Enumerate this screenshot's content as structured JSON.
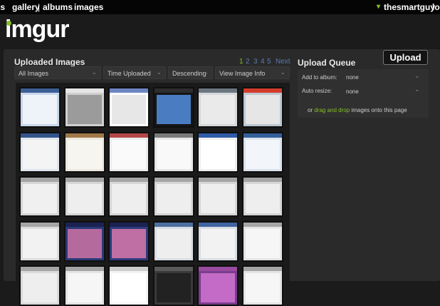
{
  "nav": {
    "left_partial": "ls",
    "gallery": "gallery",
    "separator": "|",
    "albums": "albums",
    "images": "images",
    "user_arrow": "▾",
    "username": "thesmartguy",
    "logout_partial": "log"
  },
  "logo": {
    "text": "imgur"
  },
  "uploaded": {
    "title": "Uploaded Images"
  },
  "pagination": {
    "pages": [
      "1",
      "2",
      "3",
      "4",
      "5"
    ],
    "current": "1",
    "next": "Next"
  },
  "filters": {
    "images": "All Images",
    "sort": "Time Uploaded",
    "order": "Descending",
    "view": "View Image Info",
    "chevron": "⌄"
  },
  "upload_queue": {
    "title": "Upload Queue",
    "button": "Upload",
    "album_label": "Add to album:",
    "album_value": "none",
    "resize_label": "Auto resize:",
    "resize_value": "none",
    "drop_or": "or",
    "drop_link": "drag and drop",
    "drop_rest": "images onto this page"
  },
  "colors": {
    "brand": "#85bf25",
    "link": "#5b7bb0",
    "page_bg": "#1b1b1b",
    "panel_bg": "#2a2a2a"
  },
  "thumbnails": [
    {
      "icon": "screenshot-blue",
      "bg": "#c9d7ec",
      "bar": "#3b5e95",
      "body": "#eef3fa"
    },
    {
      "icon": "meme-comic",
      "bg": "#cfcfcf",
      "bar": "#e5e5e5",
      "body": "#9b9b9b"
    },
    {
      "icon": "text-page",
      "bg": "#ffffff",
      "bar": "#6b86c2",
      "body": "#e7e7e7"
    },
    {
      "icon": "windows-satellite",
      "bg": "#151515",
      "bar": "#2d2d2d",
      "body": "#4a7cc2"
    },
    {
      "icon": "screenshot-window",
      "bg": "#d5d8da",
      "bar": "#6c7680",
      "body": "#eaeaea"
    },
    {
      "icon": "angry-birds-icon",
      "bg": "#bcc7d2",
      "bar": "#d33b2a",
      "body": "#e6e6e6"
    },
    {
      "icon": "app-store-page",
      "bg": "#e0e6ee",
      "bar": "#33558a",
      "body": "#f4f4f4"
    },
    {
      "icon": "icon-grid",
      "bg": "#ece8dd",
      "bar": "#a07948",
      "body": "#f7f5ef"
    },
    {
      "icon": "icon-grid",
      "bg": "#ececec",
      "bar": "#b54747",
      "body": "#fafafa"
    },
    {
      "icon": "icon-grid",
      "bg": "#e6e6e6",
      "bar": "#7a7a7a",
      "body": "#f9f9f9"
    },
    {
      "icon": "app-list",
      "bg": "#eeeeee",
      "bar": "#2f5aa8",
      "body": "#ffffff"
    },
    {
      "icon": "web-page",
      "bg": "#d9e2ec",
      "bar": "#335f9a",
      "body": "#f2f5f9"
    },
    {
      "icon": "screenshot",
      "bg": "#d6d6d6",
      "bar": "#a5a5a5",
      "body": "#f0f0f0"
    },
    {
      "icon": "screenshot",
      "bg": "#d6d6d6",
      "bar": "#a5a5a5",
      "body": "#eeeeee"
    },
    {
      "icon": "screenshot",
      "bg": "#d6d6d6",
      "bar": "#a5a5a5",
      "body": "#eeeeee"
    },
    {
      "icon": "screenshot",
      "bg": "#d6d6d6",
      "bar": "#a5a5a5",
      "body": "#eeeeee"
    },
    {
      "icon": "screenshot",
      "bg": "#d6d6d6",
      "bar": "#a5a5a5",
      "body": "#eeeeee"
    },
    {
      "icon": "screenshot",
      "bg": "#d6d6d6",
      "bar": "#a5a5a5",
      "body": "#eeeeee"
    },
    {
      "icon": "screenshot",
      "bg": "#dcdcdc",
      "bar": "#a5a5a5",
      "body": "#f2f2f2"
    },
    {
      "icon": "galaxy-wallpaper",
      "bg": "#2a3a78",
      "bar": "#1a2252",
      "body": "#b56a9e"
    },
    {
      "icon": "galaxy-wallpaper",
      "bg": "#2d3b7a",
      "bar": "#1a2252",
      "body": "#bf6fa4"
    },
    {
      "icon": "screenshot",
      "bg": "#d8dde4",
      "bar": "#4b6fa0",
      "body": "#eeeeee"
    },
    {
      "icon": "screenshot",
      "bg": "#d8dde4",
      "bar": "#3f64a0",
      "body": "#f2f2f2"
    },
    {
      "icon": "screenshot",
      "bg": "#e4e4e4",
      "bar": "#a5a5a5",
      "body": "#f6f6f6"
    },
    {
      "icon": "screenshot",
      "bg": "#dadada",
      "bar": "#a5a5a5",
      "body": "#eeeeee"
    },
    {
      "icon": "screenshot",
      "bg": "#e4e4e4",
      "bar": "#a5a5a5",
      "body": "#f6f6f6"
    },
    {
      "icon": "screenshot",
      "bg": "#f4f4f4",
      "bar": "#cccccc",
      "body": "#ffffff"
    },
    {
      "icon": "dark-screenshot",
      "bg": "#3a3a3a",
      "bar": "#5a5a5a",
      "body": "#222222"
    },
    {
      "icon": "purple-image",
      "bg": "#7a3d8c",
      "bar": "#9a4aa0",
      "body": "#c46bc7"
    },
    {
      "icon": "screenshot",
      "bg": "#e4e4e4",
      "bar": "#a5a5a5",
      "body": "#f6f6f6"
    }
  ]
}
